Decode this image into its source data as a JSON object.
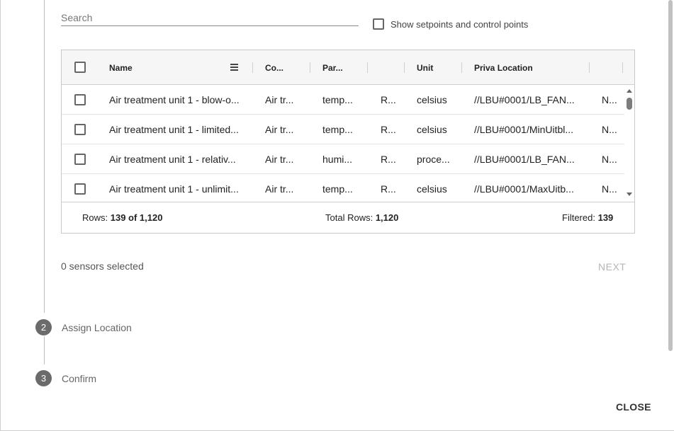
{
  "search": {
    "placeholder": "Search",
    "value": ""
  },
  "filters": {
    "show_setpoints_label": "Show setpoints and control points",
    "show_setpoints_checked": false
  },
  "table": {
    "columns": [
      "Name",
      "Co...",
      "Par...",
      "",
      "Unit",
      "Priva Location",
      ""
    ],
    "rows": [
      [
        "Air treatment unit 1 - blow-o...",
        "Air tr...",
        "temp...",
        "R...",
        "celsius",
        "//LBU#0001/LB_FAN...",
        "N..."
      ],
      [
        "Air treatment unit 1 - limited...",
        "Air tr...",
        "temp...",
        "R...",
        "celsius",
        "//LBU#0001/MinUitbl...",
        "N..."
      ],
      [
        "Air treatment unit 1 - relativ...",
        "Air tr...",
        "humi...",
        "R...",
        "proce...",
        "//LBU#0001/LB_FAN...",
        "N..."
      ],
      [
        "Air treatment unit 1 - unlimit...",
        "Air tr...",
        "temp...",
        "R...",
        "celsius",
        "//LBU#0001/MaxUitb...",
        "N..."
      ]
    ]
  },
  "footer": {
    "rows_label": "Rows:",
    "rows_value": "139 of 1,120",
    "total_label": "Total Rows:",
    "total_value": "1,120",
    "filtered_label": "Filtered:",
    "filtered_value": "139"
  },
  "selection": {
    "count_text": "0 sensors selected"
  },
  "buttons": {
    "next": "NEXT",
    "close": "CLOSE"
  },
  "steps": [
    {
      "number": "2",
      "label": "Assign Location"
    },
    {
      "number": "3",
      "label": "Confirm"
    }
  ],
  "colors": {
    "step_circle": "#6b6b6b",
    "disabled_text": "#b5b5b5"
  },
  "icons": {
    "column_menu": "menu-icon",
    "scroll_up": "arrow-up-icon",
    "scroll_down": "arrow-down-icon"
  }
}
